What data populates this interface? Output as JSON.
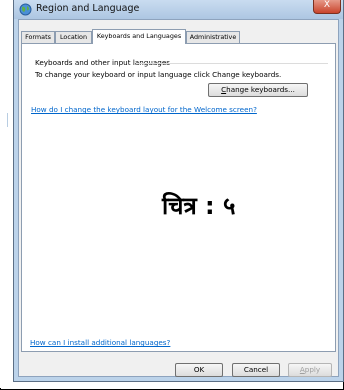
{
  "window": {
    "title": "Region and Language",
    "close_glyph": "X"
  },
  "tabs": [
    {
      "label": "Formats"
    },
    {
      "label": "Location"
    },
    {
      "label": "Keyboards and Languages"
    },
    {
      "label": "Administrative"
    }
  ],
  "keyboards_section": {
    "group_label": "Keyboards and other input languages",
    "description": "To change your keyboard or input language click Change keyboards.",
    "change_button_label_prefix": "",
    "change_button_mnemonic": "C",
    "change_button_label_rest": "hange keyboards...",
    "welcome_link": "How do I change the keyboard layout for the Welcome screen?"
  },
  "overlay_caption": "चित्र : ५",
  "install_link": "How can I install additional languages?",
  "buttons": {
    "ok": "OK",
    "cancel": "Cancel",
    "apply_mnemonic": "A",
    "apply_rest": "pply"
  },
  "icons": {
    "app_icon": "globe-icon",
    "close_icon": "close-icon"
  }
}
